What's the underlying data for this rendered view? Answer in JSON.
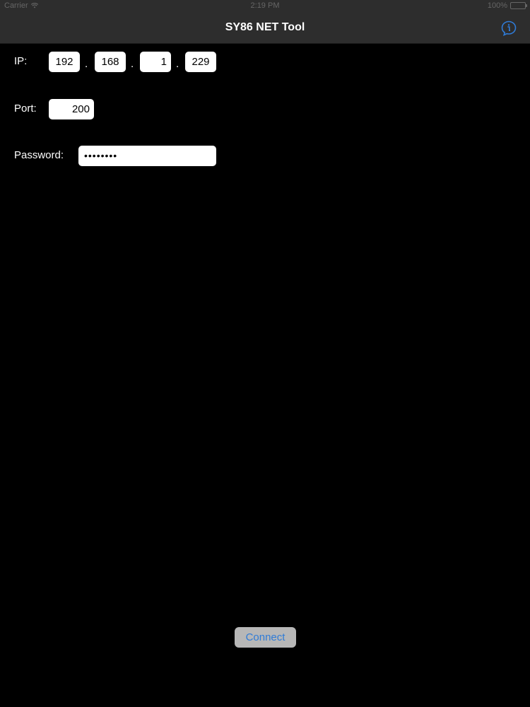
{
  "status_bar": {
    "carrier": "Carrier",
    "time": "2:19 PM",
    "battery": "100%",
    "battery_level": 1.0
  },
  "nav": {
    "title": "SY86 NET Tool",
    "info_icon": "info-icon"
  },
  "form": {
    "ip_label": "IP:",
    "ip": [
      "192",
      "168",
      "1",
      "229"
    ],
    "ip_separator": ".",
    "port_label": "Port:",
    "port": "200",
    "password_label": "Password:",
    "password_masked": "••••••••"
  },
  "actions": {
    "connect_label": "Connect"
  },
  "colors": {
    "background": "#000000",
    "nav_bar": "#2d2d2d",
    "accent": "#2f7bd7",
    "button_bg": "#b7b7b7"
  }
}
